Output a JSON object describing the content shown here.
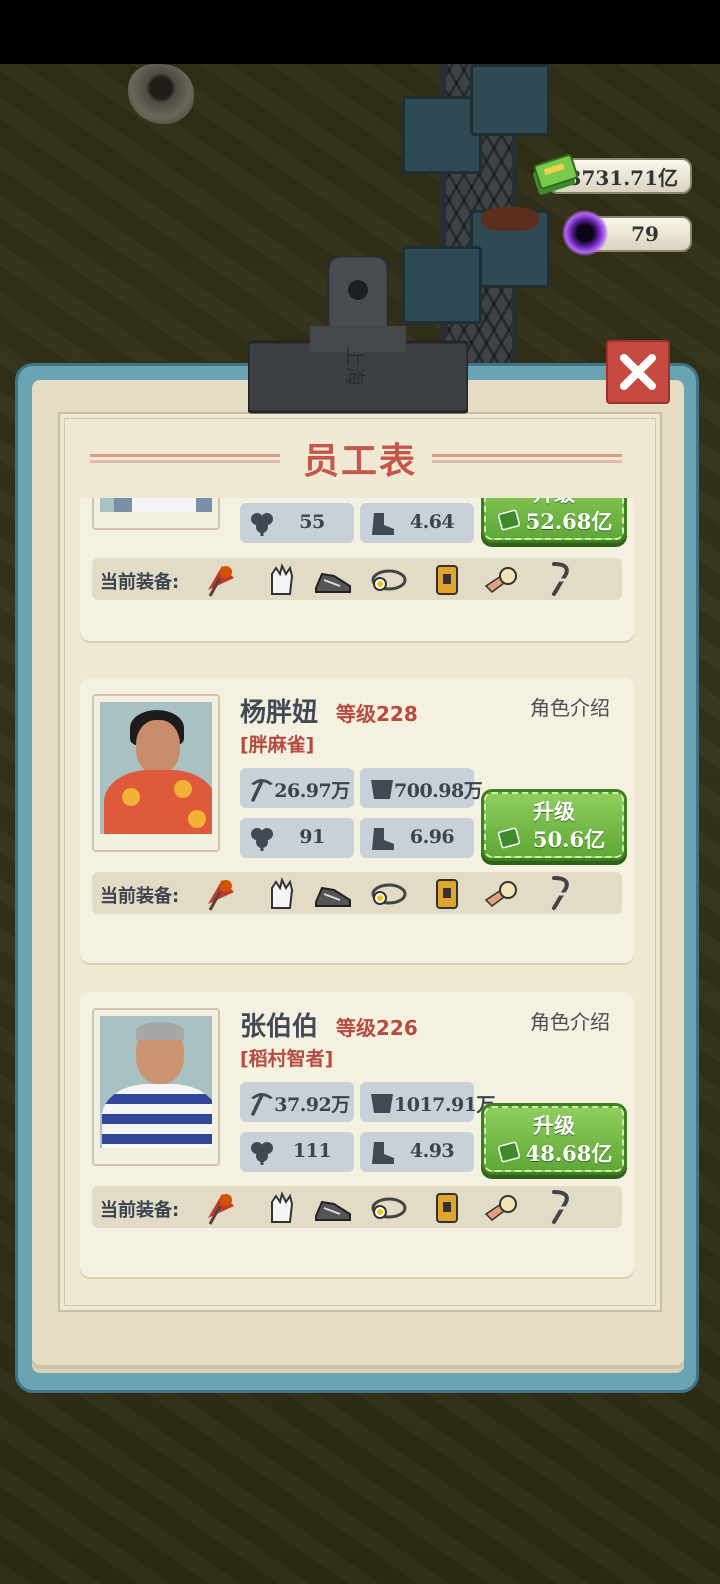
{
  "resources": {
    "money": "3731.71亿",
    "gems": "79"
  },
  "title": "员工表",
  "equip_label": "当前装备:",
  "equipment_icons": [
    "umbrella-pick-icon",
    "glove-icon",
    "shoes-icon",
    "headlamp-icon",
    "backpack-icon",
    "knee-pad-icon",
    "leg-brace-icon"
  ],
  "employees": [
    {
      "name": "",
      "level": "",
      "tag": "",
      "intro": "",
      "pick": "",
      "cart": "",
      "luck": "55",
      "speed": "4.64",
      "upgrade_label": "升级",
      "upgrade_cost": "52.68亿"
    },
    {
      "name": "杨胖妞",
      "level": "等级228",
      "tag": "[胖麻雀]",
      "intro": "角色介绍",
      "pick": "26.97万",
      "cart": "700.98万",
      "luck": "91",
      "speed": "6.96",
      "upgrade_label": "升级",
      "upgrade_cost": "50.6亿"
    },
    {
      "name": "张伯伯",
      "level": "等级226",
      "tag": "[稻村智者]",
      "intro": "角色介绍",
      "pick": "37.92万",
      "cart": "1017.91万",
      "luck": "111",
      "speed": "4.93",
      "upgrade_label": "升级",
      "upgrade_cost": "48.68亿"
    }
  ],
  "colors": {
    "accent_red": "#c4564b",
    "upgrade_green": "#6fb843",
    "frame_blue": "#6aa4b2"
  }
}
